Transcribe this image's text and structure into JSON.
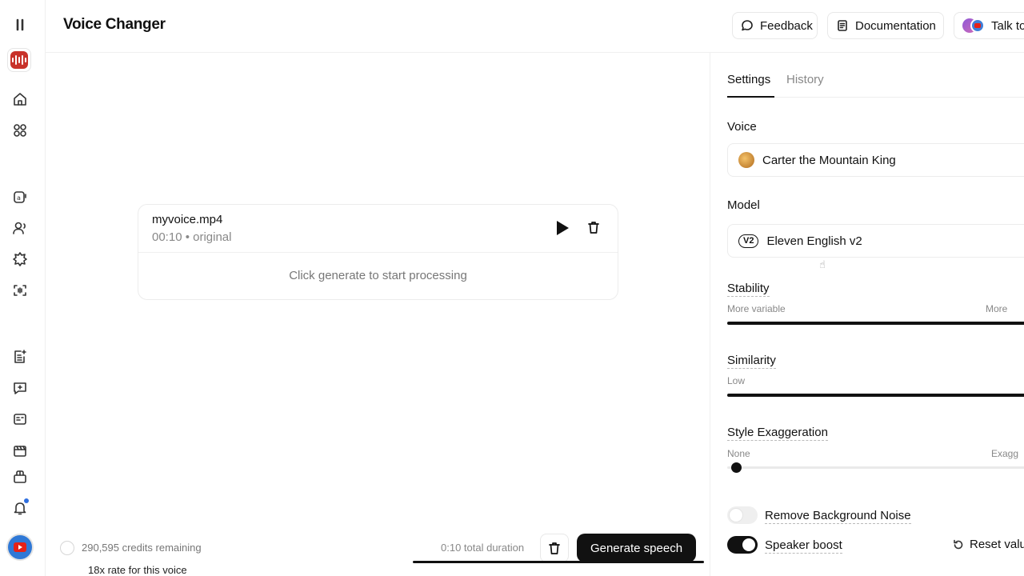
{
  "header": {
    "title": "Voice Changer",
    "feedback_label": "Feedback",
    "documentation_label": "Documentation",
    "talk_label": "Talk to"
  },
  "sidebar": {
    "items": [
      {
        "name": "pause-icon"
      },
      {
        "name": "app-logo"
      },
      {
        "name": "home-icon"
      },
      {
        "name": "grid-icon"
      },
      {
        "name": "text-to-speech-icon"
      },
      {
        "name": "voices-icon"
      },
      {
        "name": "effects-icon"
      },
      {
        "name": "voice-isolator-icon"
      },
      {
        "name": "projects-icon"
      },
      {
        "name": "chat-icon"
      },
      {
        "name": "dubbing-icon"
      },
      {
        "name": "studio-icon"
      },
      {
        "name": "library-icon"
      },
      {
        "name": "notifications-icon"
      },
      {
        "name": "user-avatar"
      }
    ]
  },
  "file_card": {
    "filename": "myvoice.mp4",
    "meta": "00:10 • original",
    "hint": "Click generate to start processing"
  },
  "footer": {
    "credits": "290,595 credits remaining",
    "rate": "18x rate for this voice",
    "duration": "0:10 total duration",
    "generate_label": "Generate speech"
  },
  "panel": {
    "tabs": [
      {
        "label": "Settings",
        "active": true
      },
      {
        "label": "History",
        "active": false
      }
    ],
    "voice": {
      "label": "Voice",
      "value": "Carter the Mountain King"
    },
    "model": {
      "label": "Model",
      "badge": "V2",
      "value": "Eleven English v2"
    },
    "stability": {
      "label": "Stability",
      "min_label": "More variable",
      "max_label": "More"
    },
    "similarity": {
      "label": "Similarity",
      "min_label": "Low"
    },
    "style": {
      "label": "Style Exaggeration",
      "min_label": "None",
      "max_label": "Exagg",
      "level": 0.03
    },
    "remove_noise": {
      "label": "Remove Background Noise",
      "on": false
    },
    "speaker_boost": {
      "label": "Speaker boost",
      "on": true
    },
    "reset_label": "Reset valu"
  },
  "colors": {
    "accent": "#111111",
    "logo": "#c8322a",
    "notification": "#2f6fe0"
  }
}
